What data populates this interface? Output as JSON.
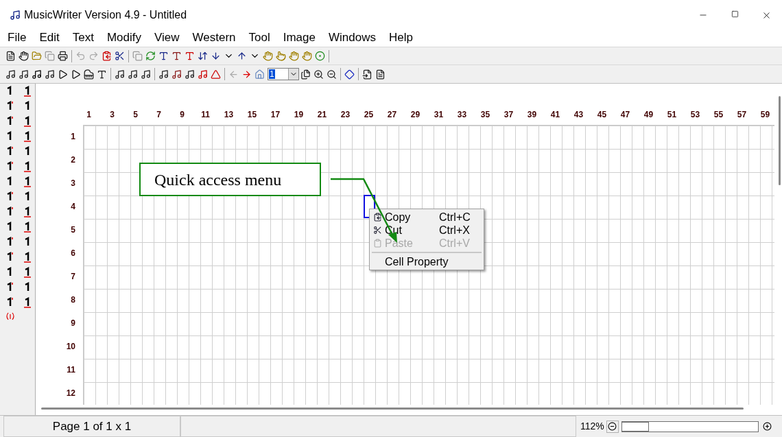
{
  "window": {
    "title": "MusicWriter Version 4.9 - Untitled"
  },
  "menu": [
    "File",
    "Edit",
    "Text",
    "Modify",
    "View",
    "Western",
    "Tool",
    "Image",
    "Windows",
    "Help"
  ],
  "toolbar": {
    "page_select": {
      "value": "1"
    }
  },
  "grid": {
    "column_headers": [
      "1",
      "3",
      "5",
      "7",
      "9",
      "11",
      "13",
      "15",
      "17",
      "19",
      "21",
      "23",
      "25",
      "27",
      "29",
      "31",
      "33",
      "35",
      "37",
      "39",
      "41",
      "43",
      "45",
      "47",
      "49",
      "51",
      "53",
      "55",
      "57",
      "59"
    ],
    "row_headers": [
      "1",
      "2",
      "3",
      "4",
      "5",
      "6",
      "7",
      "8",
      "9",
      "10",
      "11",
      "12"
    ]
  },
  "callout": {
    "text": "Quick access menu"
  },
  "context_menu": [
    {
      "kind": "item",
      "label": "Copy",
      "shortcut": "Ctrl+C",
      "disabled": false
    },
    {
      "kind": "item",
      "label": "Cut",
      "shortcut": "Ctrl+X",
      "disabled": false
    },
    {
      "kind": "item",
      "label": "Paste",
      "shortcut": "Ctrl+V",
      "disabled": true
    },
    {
      "kind": "separator"
    },
    {
      "kind": "item",
      "label": "Cell Property",
      "disabled": false
    }
  ],
  "status_bar": {
    "page": "Page 1 of 1 x 1",
    "zoom": "112%",
    "zoom_slider": {
      "level": 0.2
    }
  }
}
